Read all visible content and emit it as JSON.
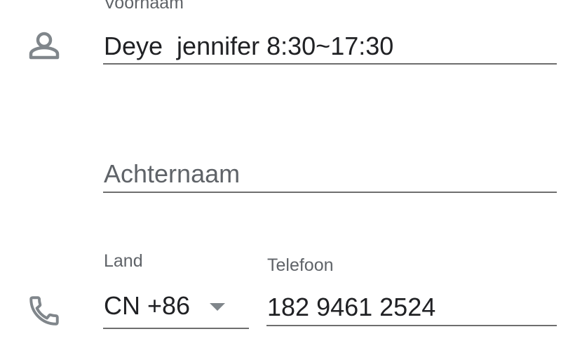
{
  "first_name": {
    "label": "Voornaam",
    "value": "Deye  jennifer 8:30~17:30",
    "icon": "person-icon"
  },
  "last_name": {
    "placeholder": "Achternaam",
    "value": ""
  },
  "country": {
    "label": "Land",
    "value": "CN +86"
  },
  "phone": {
    "label": "Telefoon",
    "value": "182 9461 2524",
    "icon": "phone-icon"
  },
  "colors": {
    "icon": "#80868b",
    "label": "#5f6368",
    "text": "#202124",
    "underline": "#6e6e6e"
  }
}
